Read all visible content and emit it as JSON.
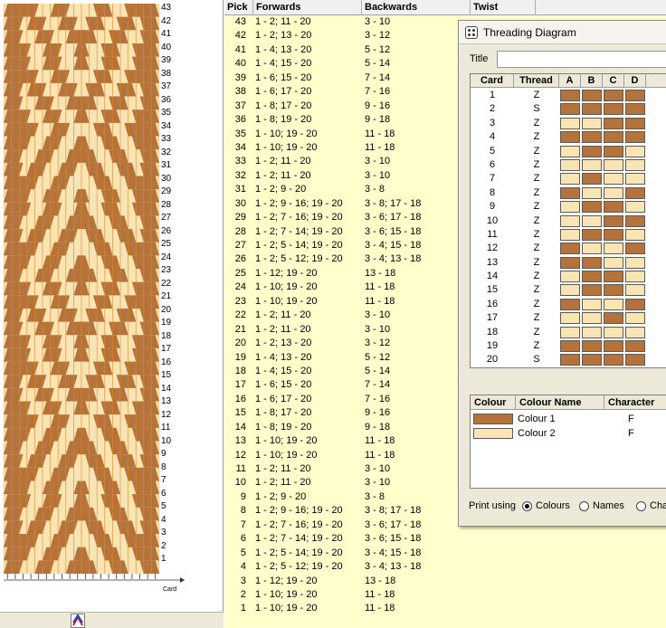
{
  "colors": {
    "colour1": "#b5733c",
    "colour2": "#f9e4b4",
    "thread_line": "#e8841f",
    "table_bg": "#ffffcc"
  },
  "pattern": {
    "row_numbers": [
      "43",
      "42",
      "41",
      "40",
      "39",
      "38",
      "37",
      "36",
      "35",
      "34",
      "33",
      "32",
      "31",
      "30",
      "29",
      "28",
      "27",
      "26",
      "25",
      "24",
      "23",
      "22",
      "21",
      "20",
      "19",
      "18",
      "17",
      "16",
      "15",
      "14",
      "13",
      "12",
      "11",
      "10",
      "9",
      "8",
      "7",
      "6",
      "5",
      "4",
      "3",
      "2",
      "1"
    ],
    "card_axis_label": "Card",
    "status_icon": "weave-icon"
  },
  "pick_table": {
    "headers": {
      "pick": "Pick",
      "forwards": "Forwards",
      "backwards": "Backwards",
      "twist": "Twist"
    },
    "rows": [
      {
        "pick": "43",
        "forwards": "1 - 2; 11 - 20",
        "backwards": "3 - 10"
      },
      {
        "pick": "42",
        "forwards": "1 - 2; 13 - 20",
        "backwards": "3 - 12"
      },
      {
        "pick": "41",
        "forwards": "1 - 4; 13 - 20",
        "backwards": "5 - 12"
      },
      {
        "pick": "40",
        "forwards": "1 - 4; 15 - 20",
        "backwards": "5 - 14"
      },
      {
        "pick": "39",
        "forwards": "1 - 6; 15 - 20",
        "backwards": "7 - 14"
      },
      {
        "pick": "38",
        "forwards": "1 - 6; 17 - 20",
        "backwards": "7 - 16"
      },
      {
        "pick": "37",
        "forwards": "1 - 8; 17 - 20",
        "backwards": "9 - 16"
      },
      {
        "pick": "36",
        "forwards": "1 - 8; 19 - 20",
        "backwards": "9 - 18"
      },
      {
        "pick": "35",
        "forwards": "1 - 10; 19 - 20",
        "backwards": "11 - 18"
      },
      {
        "pick": "34",
        "forwards": "1 - 10; 19 - 20",
        "backwards": "11 - 18"
      },
      {
        "pick": "33",
        "forwards": "1 - 2; 11 - 20",
        "backwards": "3 - 10"
      },
      {
        "pick": "32",
        "forwards": "1 - 2; 11 - 20",
        "backwards": "3 - 10"
      },
      {
        "pick": "31",
        "forwards": "1 - 2; 9 - 20",
        "backwards": "3 - 8"
      },
      {
        "pick": "30",
        "forwards": "1 - 2; 9 - 16; 19 - 20",
        "backwards": "3 - 8; 17 - 18"
      },
      {
        "pick": "29",
        "forwards": "1 - 2; 7 - 16; 19 - 20",
        "backwards": "3 - 6; 17 - 18"
      },
      {
        "pick": "28",
        "forwards": "1 - 2; 7 - 14; 19 - 20",
        "backwards": "3 - 6; 15 - 18"
      },
      {
        "pick": "27",
        "forwards": "1 - 2; 5 - 14; 19 - 20",
        "backwards": "3 - 4; 15 - 18"
      },
      {
        "pick": "26",
        "forwards": "1 - 2; 5 - 12; 19 - 20",
        "backwards": "3 - 4; 13 - 18"
      },
      {
        "pick": "25",
        "forwards": "1 - 12; 19 - 20",
        "backwards": "13 - 18"
      },
      {
        "pick": "24",
        "forwards": "1 - 10; 19 - 20",
        "backwards": "11 - 18"
      },
      {
        "pick": "23",
        "forwards": "1 - 10; 19 - 20",
        "backwards": "11 - 18"
      },
      {
        "pick": "22",
        "forwards": "1 - 2; 11 - 20",
        "backwards": "3 - 10"
      },
      {
        "pick": "21",
        "forwards": "1 - 2; 11 - 20",
        "backwards": "3 - 10"
      },
      {
        "pick": "20",
        "forwards": "1 - 2; 13 - 20",
        "backwards": "3 - 12"
      },
      {
        "pick": "19",
        "forwards": "1 - 4; 13 - 20",
        "backwards": "5 - 12"
      },
      {
        "pick": "18",
        "forwards": "1 - 4; 15 - 20",
        "backwards": "5 - 14"
      },
      {
        "pick": "17",
        "forwards": "1 - 6; 15 - 20",
        "backwards": "7 - 14"
      },
      {
        "pick": "16",
        "forwards": "1 - 6; 17 - 20",
        "backwards": "7 - 16"
      },
      {
        "pick": "15",
        "forwards": "1 - 8; 17 - 20",
        "backwards": "9 - 16"
      },
      {
        "pick": "14",
        "forwards": "1 - 8; 19 - 20",
        "backwards": "9 - 18"
      },
      {
        "pick": "13",
        "forwards": "1 - 10; 19 - 20",
        "backwards": "11 - 18"
      },
      {
        "pick": "12",
        "forwards": "1 - 10; 19 - 20",
        "backwards": "11 - 18"
      },
      {
        "pick": "11",
        "forwards": "1 - 2; 11 - 20",
        "backwards": "3 - 10"
      },
      {
        "pick": "10",
        "forwards": "1 - 2; 11 - 20",
        "backwards": "3 - 10"
      },
      {
        "pick": "9",
        "forwards": "1 - 2; 9 - 20",
        "backwards": "3 - 8"
      },
      {
        "pick": "8",
        "forwards": "1 - 2; 9 - 16; 19 - 20",
        "backwards": "3 - 8; 17 - 18"
      },
      {
        "pick": "7",
        "forwards": "1 - 2; 7 - 16; 19 - 20",
        "backwards": "3 - 6; 17 - 18"
      },
      {
        "pick": "6",
        "forwards": "1 - 2; 7 - 14; 19 - 20",
        "backwards": "3 - 6; 15 - 18"
      },
      {
        "pick": "5",
        "forwards": "1 - 2; 5 - 14; 19 - 20",
        "backwards": "3 - 4; 15 - 18"
      },
      {
        "pick": "4",
        "forwards": "1 - 2; 5 - 12; 19 - 20",
        "backwards": "3 - 4; 13 - 18"
      },
      {
        "pick": "3",
        "forwards": "1 - 12; 19 - 20",
        "backwards": "13 - 18"
      },
      {
        "pick": "2",
        "forwards": "1 - 10; 19 - 20",
        "backwards": "11 - 18"
      },
      {
        "pick": "1",
        "forwards": "1 - 10; 19 - 20",
        "backwards": "11 - 18"
      }
    ]
  },
  "threading_window": {
    "title": "Threading Diagram",
    "title_icon": "dice-icon",
    "title_field_label": "Title",
    "title_field_value": "",
    "grid_headers": {
      "card": "Card",
      "thread": "Thread",
      "a": "A",
      "b": "B",
      "c": "C",
      "d": "D"
    },
    "cards": [
      {
        "card": "1",
        "thread": "Z",
        "holes": [
          1,
          1,
          1,
          1
        ]
      },
      {
        "card": "2",
        "thread": "S",
        "holes": [
          1,
          1,
          1,
          1
        ]
      },
      {
        "card": "3",
        "thread": "Z",
        "holes": [
          2,
          2,
          1,
          1
        ]
      },
      {
        "card": "4",
        "thread": "Z",
        "holes": [
          1,
          1,
          1,
          1
        ]
      },
      {
        "card": "5",
        "thread": "Z",
        "holes": [
          2,
          1,
          1,
          2
        ]
      },
      {
        "card": "6",
        "thread": "Z",
        "holes": [
          2,
          2,
          2,
          2
        ]
      },
      {
        "card": "7",
        "thread": "Z",
        "holes": [
          2,
          1,
          2,
          2
        ]
      },
      {
        "card": "8",
        "thread": "Z",
        "holes": [
          1,
          2,
          2,
          1
        ]
      },
      {
        "card": "9",
        "thread": "Z",
        "holes": [
          2,
          1,
          1,
          2
        ]
      },
      {
        "card": "10",
        "thread": "Z",
        "holes": [
          2,
          2,
          1,
          1
        ]
      },
      {
        "card": "11",
        "thread": "Z",
        "holes": [
          2,
          1,
          1,
          2
        ]
      },
      {
        "card": "12",
        "thread": "Z",
        "holes": [
          1,
          2,
          2,
          1
        ]
      },
      {
        "card": "13",
        "thread": "Z",
        "holes": [
          1,
          1,
          2,
          2
        ]
      },
      {
        "card": "14",
        "thread": "Z",
        "holes": [
          2,
          1,
          1,
          2
        ]
      },
      {
        "card": "15",
        "thread": "Z",
        "holes": [
          2,
          1,
          1,
          2
        ]
      },
      {
        "card": "16",
        "thread": "Z",
        "holes": [
          1,
          2,
          2,
          1
        ]
      },
      {
        "card": "17",
        "thread": "Z",
        "holes": [
          2,
          2,
          1,
          2
        ]
      },
      {
        "card": "18",
        "thread": "Z",
        "holes": [
          2,
          2,
          2,
          2
        ]
      },
      {
        "card": "19",
        "thread": "Z",
        "holes": [
          1,
          1,
          1,
          1
        ]
      },
      {
        "card": "20",
        "thread": "S",
        "holes": [
          1,
          1,
          1,
          1
        ]
      }
    ],
    "colour_headers": {
      "colour": "Colour",
      "name": "Colour Name",
      "character": "Character"
    },
    "colours": [
      {
        "swatch": "#b5733c",
        "name": "Colour 1",
        "character": "F"
      },
      {
        "swatch": "#f9e4b4",
        "name": "Colour 2",
        "character": "F"
      }
    ],
    "print_using": {
      "label": "Print using",
      "options": [
        "Colours",
        "Names",
        "Cha"
      ],
      "selected": "Colours"
    }
  }
}
